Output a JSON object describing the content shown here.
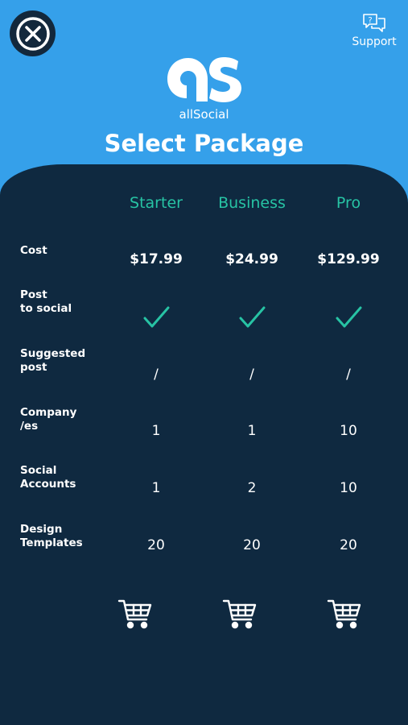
{
  "header": {
    "close_icon": "close-icon",
    "support_label": "Support",
    "support_icon": "chat-question-icon",
    "brand_name": "allSocial",
    "title": "Select Package"
  },
  "colors": {
    "header_bg": "#35a0ea",
    "panel_bg": "#0f2940",
    "plan_accent": "#27c3a4",
    "text": "#ffffff"
  },
  "plans": [
    {
      "name": "Starter"
    },
    {
      "name": "Business"
    },
    {
      "name": "Pro"
    }
  ],
  "rows": [
    {
      "label": "Cost",
      "values": [
        "$17.99",
        "$24.99",
        "$129.99"
      ]
    },
    {
      "label": "Post\nto social",
      "values": [
        "check",
        "check",
        "check"
      ]
    },
    {
      "label": "Suggested\npost",
      "values": [
        "/",
        "/",
        "/"
      ]
    },
    {
      "label": "Company\n/es",
      "values": [
        "1",
        "1",
        "10"
      ]
    },
    {
      "label": "Social\nAccounts",
      "values": [
        "1",
        "2",
        "10"
      ]
    },
    {
      "label": "Design\nTemplates",
      "values": [
        "20",
        "20",
        "20"
      ]
    }
  ],
  "buy_icon": "shopping-cart-icon"
}
